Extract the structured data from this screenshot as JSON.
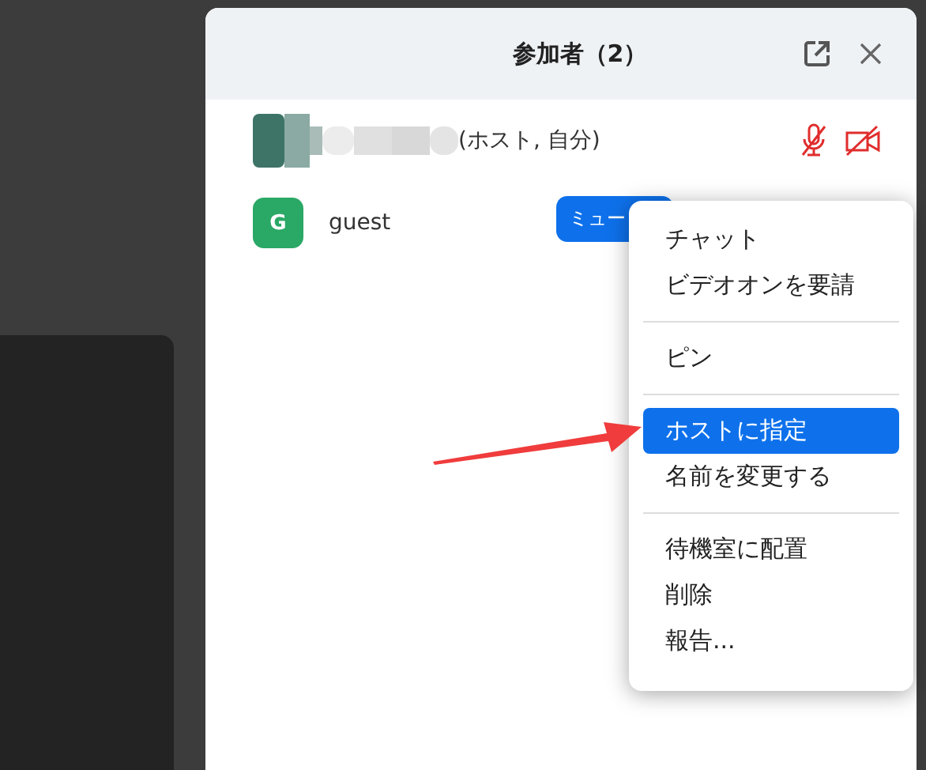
{
  "panel": {
    "title": "参加者（2）"
  },
  "participants": [
    {
      "kind": "self",
      "name": "(ホスト, 自分)",
      "mic_muted": true,
      "video_off": true
    },
    {
      "kind": "guest",
      "avatar": "G",
      "name": "guest",
      "button": "ミュー"
    }
  ],
  "context_menu": {
    "groups": [
      [
        {
          "label": "チャット",
          "selected": false
        },
        {
          "label": "ビデオオンを要請",
          "selected": false
        }
      ],
      [
        {
          "label": "ピン",
          "selected": false
        }
      ],
      [
        {
          "label": "ホストに指定",
          "selected": true
        },
        {
          "label": "名前を変更する",
          "selected": false
        }
      ],
      [
        {
          "label": "待機室に配置",
          "selected": false
        },
        {
          "label": "削除",
          "selected": false
        },
        {
          "label": "報告...",
          "selected": false
        }
      ]
    ]
  }
}
